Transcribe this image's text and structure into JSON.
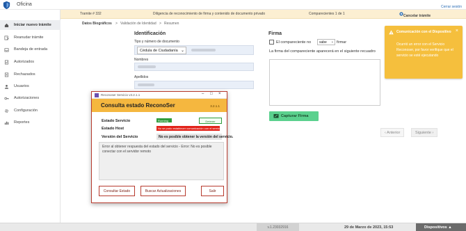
{
  "app": {
    "title": "Oficina",
    "logout": "Cerrar sesión"
  },
  "sidebar": {
    "items": [
      {
        "label": "Iniciar nuevo trámite",
        "icon": "home-icon",
        "active": true
      },
      {
        "label": "Reanudar trámite",
        "icon": "resume-icon"
      },
      {
        "label": "Bandeja de entrada",
        "icon": "inbox-icon"
      },
      {
        "label": "Autorizados",
        "icon": "doc-check-icon"
      },
      {
        "label": "Rechazados",
        "icon": "doc-reject-icon"
      },
      {
        "label": "Usuarios",
        "icon": "user-icon"
      },
      {
        "label": "Autorizaciones",
        "icon": "key-icon"
      },
      {
        "label": "Configuración",
        "icon": "gear-icon"
      },
      {
        "label": "Reportes",
        "icon": "report-icon"
      }
    ]
  },
  "banner": {
    "tramite": "Tramite # 332",
    "descripcion": "Diligencia de reconocimiento de firma y contenido de documento privado",
    "comparecientes": "Comparecientes 1 de 1",
    "cancel": "Cancelar trámite"
  },
  "breadcrumb": {
    "step1": "Datos Biográficos",
    "sep": ">",
    "step2": "Validación de Identidad",
    "step3": "Resumen"
  },
  "identificacion": {
    "title": "Identificación",
    "tipo_label": "Tipo y número de documento",
    "tipo_value": "Cédula de Ciudadanía",
    "nombres_label": "Nombres",
    "apellidos_label": "Apellidos"
  },
  "firma": {
    "title": "Firma",
    "checkbox_prefix": "El compareciente no",
    "select_value": "sabe",
    "checkbox_suffix": "firmar",
    "note": "La firma del compareciente aparecerá en el siguiente recuadro",
    "capture_label": "Capturar Firma"
  },
  "nav": {
    "prev": "‹ Anterior",
    "next": "Siguiente ›"
  },
  "toast": {
    "title": "Comunicación con el Dispositivo",
    "body": "Ocurrió un error con el Servicio Reconoser, por favor verifique que el servicio se esté ejecutando",
    "close": "×"
  },
  "dialog": {
    "window_title": "Reconoser Servicio v3.2.1.1",
    "header": "Consulta estado ReconoSer",
    "version_badge": "3.2.1.1",
    "row_service_label": "Estado Servicio",
    "service_status": "Running",
    "stop_button": "Detener",
    "row_host_label": "Estado Host",
    "host_status": "No se pudo establecer comunicación con el servicio.",
    "row_version_label": "Versión del Servicio",
    "version_status": "No es posible obtener la versión del servicio.",
    "log": "Error al obtener respuesta del estado del servicio - Error: No es posible conectar con el servidor remoto",
    "btn_consultar": "Consultar Estado",
    "btn_buscar": "Buscar Actualizaciones",
    "btn_salir": "Salir"
  },
  "statusbar": {
    "version": "v.1.23032916",
    "date": "29 de Marzo de 2023, 15:53",
    "devices": "Dispositivos ▲"
  },
  "colors": {
    "accent_blue": "#2a6db5",
    "banner_bg": "#fcefd2",
    "warning": "#f5bf3d",
    "success": "#5bd18e",
    "error": "#e2231a"
  }
}
